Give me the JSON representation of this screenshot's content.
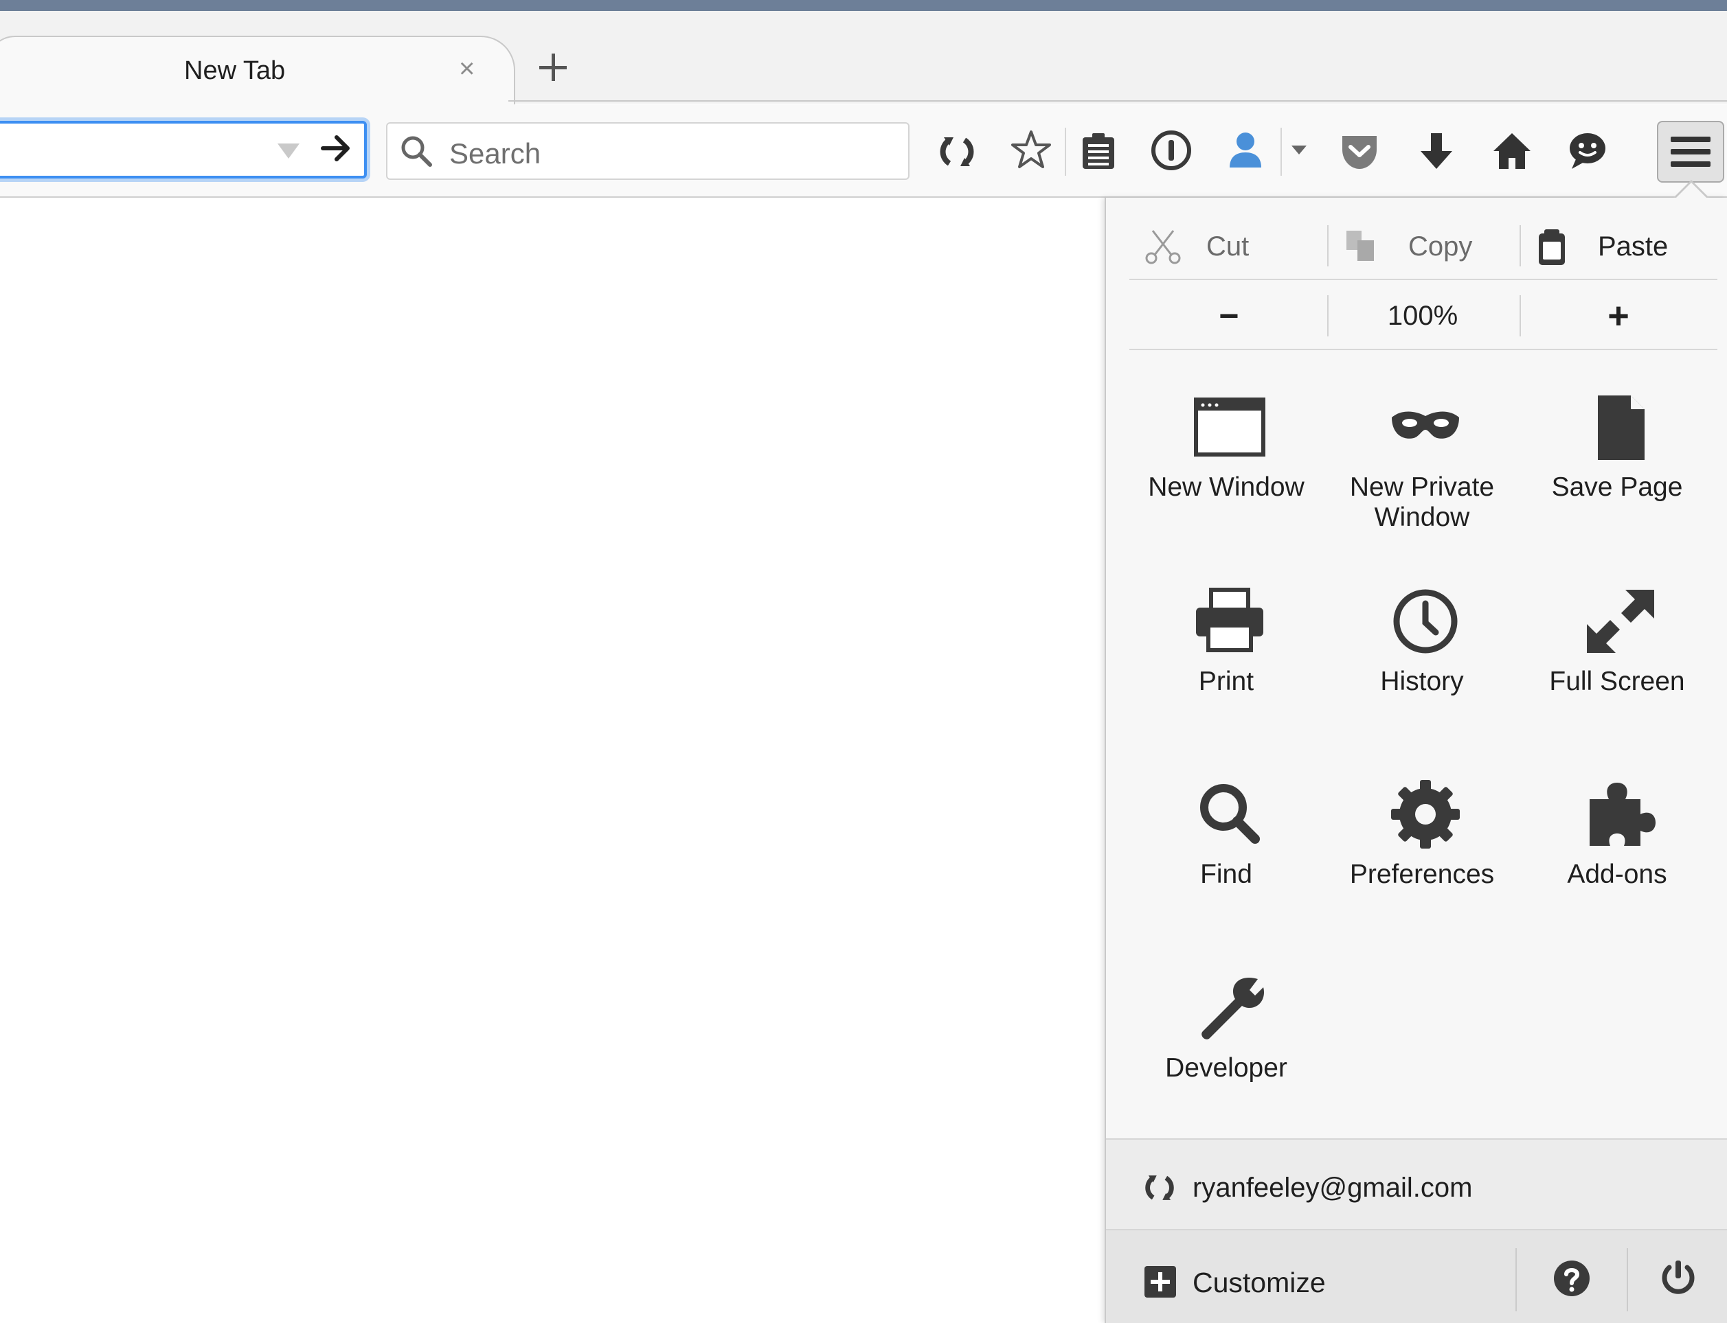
{
  "tab": {
    "title": "New Tab"
  },
  "search": {
    "placeholder": "Search"
  },
  "edit": {
    "cut": "Cut",
    "copy": "Copy",
    "paste": "Paste"
  },
  "zoom": {
    "minus": "−",
    "level": "100%",
    "plus": "+"
  },
  "grid": {
    "new_window": "New Window",
    "new_private_window_line1": "New Private",
    "new_private_window_line2": "Window",
    "save_page": "Save Page",
    "print": "Print",
    "history": "History",
    "full_screen": "Full Screen",
    "find": "Find",
    "preferences": "Preferences",
    "addons": "Add-ons",
    "developer": "Developer"
  },
  "account": {
    "email": "ryanfeeley@gmail.com"
  },
  "footer": {
    "customize": "Customize"
  },
  "colors": {
    "accent": "#3d8ff2",
    "icon": "#4a4a4a",
    "sync_blue": "#4a90d9"
  }
}
